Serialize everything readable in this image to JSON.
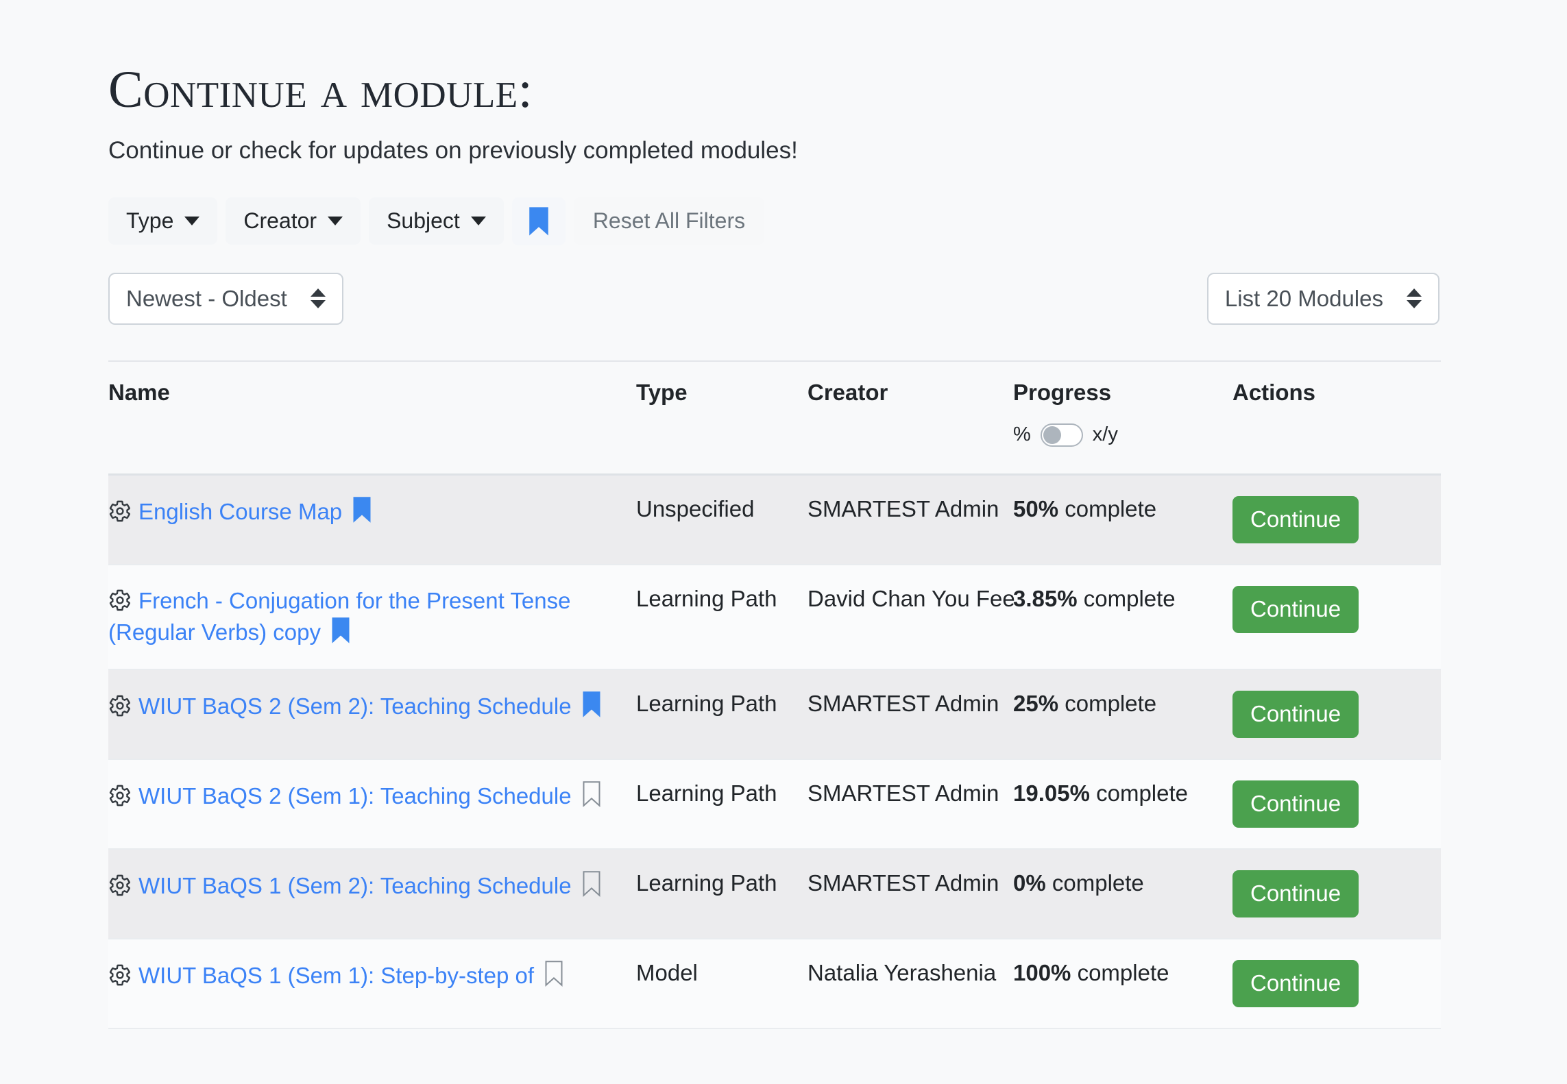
{
  "header": {
    "title": "Continue a module:",
    "subtitle": "Continue or check for updates on previously completed modules!"
  },
  "filters": {
    "type_label": "Type",
    "creator_label": "Creator",
    "subject_label": "Subject",
    "bookmark_icon": "bookmark-filled-icon",
    "reset_label": "Reset All Filters"
  },
  "controls": {
    "sort_value": "Newest - Oldest",
    "count_value": "List 20 Modules"
  },
  "table": {
    "columns": {
      "name": "Name",
      "type": "Type",
      "creator": "Creator",
      "progress": "Progress",
      "actions": "Actions"
    },
    "progress_toggle": {
      "left_label": "%",
      "right_label": "x/y",
      "state": "off"
    },
    "action_label": "Continue",
    "rows": [
      {
        "name": "English Course Map",
        "bookmarked": true,
        "type": "Unspecified",
        "creator": "SMARTEST Admin",
        "progress_value": "50%",
        "progress_suffix": " complete",
        "action": "Continue"
      },
      {
        "name": "French - Conjugation for the Present Tense (Regular Verbs) copy",
        "bookmarked": true,
        "type": "Learning Path",
        "creator": "David Chan You Fee",
        "progress_value": "3.85%",
        "progress_suffix": " complete",
        "action": "Continue"
      },
      {
        "name": "WIUT BaQS 2 (Sem 2): Teaching Schedule",
        "bookmarked": true,
        "type": "Learning Path",
        "creator": "SMARTEST Admin",
        "progress_value": "25%",
        "progress_suffix": " complete",
        "action": "Continue"
      },
      {
        "name": "WIUT BaQS 2 (Sem 1): Teaching Schedule",
        "bookmarked": false,
        "type": "Learning Path",
        "creator": "SMARTEST Admin",
        "progress_value": "19.05%",
        "progress_suffix": " complete",
        "action": "Continue"
      },
      {
        "name": "WIUT BaQS 1 (Sem 2): Teaching Schedule",
        "bookmarked": false,
        "type": "Learning Path",
        "creator": "SMARTEST Admin",
        "progress_value": "0%",
        "progress_suffix": " complete",
        "action": "Continue"
      },
      {
        "name": "WIUT BaQS 1 (Sem 1): Step-by-step of",
        "bookmarked": false,
        "type": "Model",
        "creator": "Natalia Yerashenia",
        "progress_value": "100%",
        "progress_suffix": " complete",
        "action": "Continue"
      }
    ]
  },
  "colors": {
    "link_blue": "#3b82f6",
    "bookmark_blue": "#3b88f0",
    "continue_green": "#4ba14e",
    "page_bg": "#f8f9fa",
    "row_stripe": "#ececee"
  }
}
